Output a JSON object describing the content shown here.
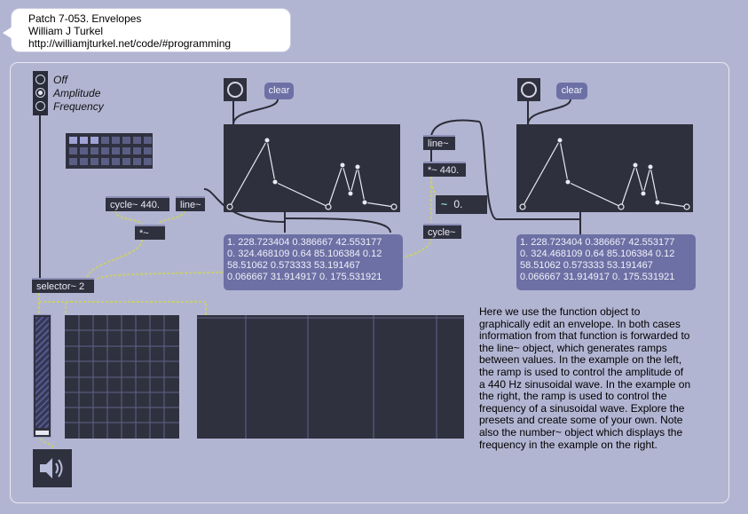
{
  "header_comment": {
    "line1": "Patch 7-053. Envelopes",
    "line2": "William J Turkel",
    "line3": "http://williamjturkel.net/code/#programming"
  },
  "radio": {
    "options": [
      "Off",
      "Amplitude",
      "Frequency"
    ],
    "selected_index": 1
  },
  "objects": {
    "cycle_left": "cycle~ 440.",
    "line_left": "line~",
    "times_left": "*~",
    "selector": "selector~ 2",
    "line_right": "line~",
    "times_right": "*~ 440.",
    "cycle_right": "cycle~"
  },
  "messages": {
    "clear_left": "clear",
    "clear_right": "clear"
  },
  "number_box": {
    "icon": "tilde-icon",
    "value": "0."
  },
  "list_left": "1. 228.723404 0.386667 42.553177\n0. 324.468109 0.64 85.106384 0.12\n58.51062 0.573333 53.191467\n0.066667 31.914917 0. 175.531921",
  "list_right": "1. 228.723404 0.386667 42.553177\n0. 324.468109 0.64 85.106384 0.12\n58.51062 0.573333 53.191467\n0.066667 31.914917 0. 175.531921",
  "envelope_breakpoints": [
    [
      0.0,
      0.0
    ],
    [
      228.723404,
      0.386667
    ],
    [
      42.553177,
      0.0
    ],
    [
      324.468109,
      0.64
    ],
    [
      85.106384,
      0.12
    ],
    [
      58.51062,
      0.573333
    ],
    [
      53.191467,
      0.066667
    ],
    [
      31.914917,
      0.0
    ],
    [
      175.531921,
      0.0
    ]
  ],
  "description": "Here we use the function object to graphically edit an envelope. In both cases information from that function is forwarded to the line~ object, which generates ramps between values. In the example on the left, the ramp is used to control the amplitude of a 440 Hz sinusoidal wave.  In the example on the right, the ramp is used to control the frequency of a sinusoidal wave. Explore the presets and create some of your own. Note also the number~ object which displays the frequency in the example on the right.",
  "icons": {
    "bang": "bang-circle-icon",
    "speaker": "speaker-icon"
  },
  "colors": {
    "background": "#b2b5d2",
    "object_fill": "#30313f",
    "message_fill": "#6d70a4",
    "patch_cord_signal": "#c8cf6e",
    "patch_cord_control": "#2a2b36"
  }
}
